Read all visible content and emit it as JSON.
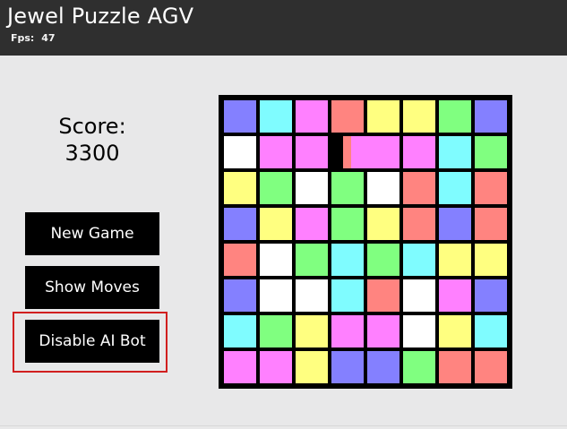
{
  "app": {
    "title": "Jewel Puzzle AGV",
    "fps_label": "Fps:",
    "fps_value": "47"
  },
  "score": {
    "label": "Score:",
    "value": "3300"
  },
  "buttons": {
    "new_game": "New Game",
    "show_moves": "Show Moves",
    "disable_ai_bot": "Disable AI Bot"
  },
  "colors": {
    "background": "#e8e8e9",
    "header_bg": "#2f2f2f",
    "board_border": "#000000",
    "highlight_border": "#d11f1f",
    "tile_palette": {
      "blue": "#8480ff",
      "cyan": "#7ffcff",
      "pink": "#ff80ff",
      "salmon": "#ff8480",
      "yellow": "#ffff80",
      "green": "#80ff80",
      "white": "#ffffff"
    }
  },
  "board": {
    "rows": 8,
    "cols": 8,
    "grid": [
      [
        "blue",
        "cyan",
        "pink",
        "salmon",
        "yellow",
        "yellow",
        "green",
        "blue"
      ],
      [
        "white",
        "pink",
        "pink",
        "empty",
        "pink",
        "pink",
        "cyan",
        "green"
      ],
      [
        "yellow",
        "green",
        "white",
        "green",
        "white",
        "salmon",
        "cyan",
        "salmon"
      ],
      [
        "blue",
        "yellow",
        "pink",
        "green",
        "yellow",
        "salmon",
        "blue",
        "salmon"
      ],
      [
        "salmon",
        "white",
        "green",
        "cyan",
        "green",
        "cyan",
        "yellow",
        "yellow"
      ],
      [
        "blue",
        "white",
        "white",
        "cyan",
        "salmon",
        "white",
        "pink",
        "blue"
      ],
      [
        "cyan",
        "green",
        "yellow",
        "pink",
        "pink",
        "white",
        "yellow",
        "cyan"
      ],
      [
        "pink",
        "pink",
        "yellow",
        "blue",
        "blue",
        "green",
        "salmon",
        "salmon"
      ]
    ]
  },
  "animation": {
    "swap_row": 1,
    "swap_cols": [
      3,
      4
    ],
    "swap_progress": 0.72
  }
}
